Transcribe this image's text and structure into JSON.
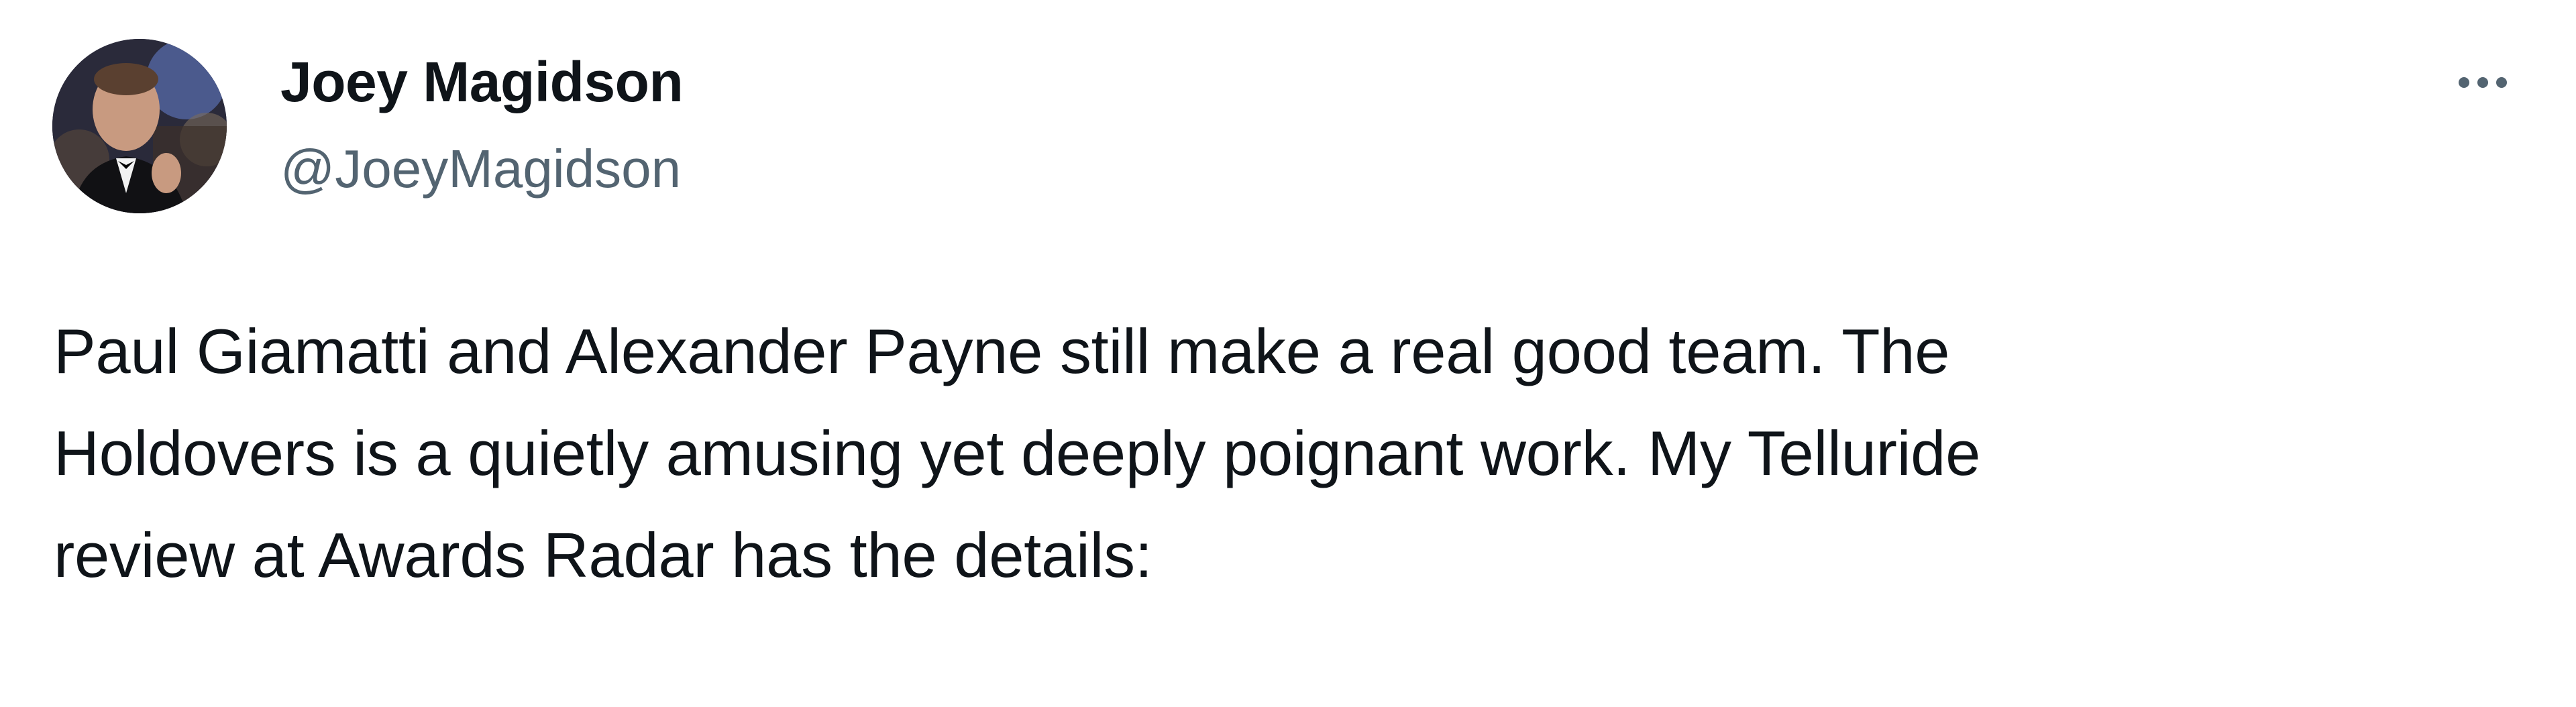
{
  "tweet": {
    "author": {
      "name": "Joey Magidson",
      "handle": "@JoeyMagidson",
      "avatar_icon": "user-avatar-photo"
    },
    "more_icon": "more-horizontal-icon",
    "text": "Paul Giamatti and Alexander Payne still make a real good team. The\nHoldovers is a quietly amusing yet deeply poignant work. My Telluride\nreview at Awards Radar has the details:"
  },
  "colors": {
    "text_primary": "#0f1419",
    "text_secondary": "#536471",
    "background": "#ffffff"
  }
}
